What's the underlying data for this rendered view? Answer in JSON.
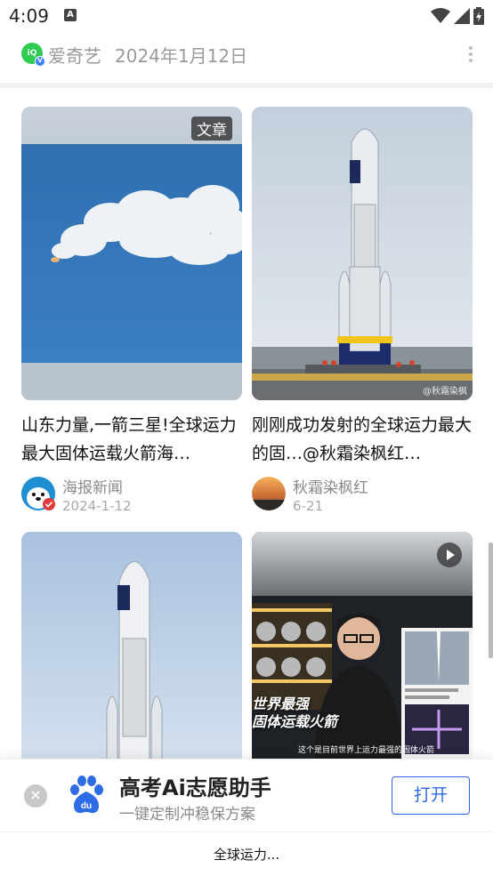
{
  "status_bar": {
    "time": "4:09"
  },
  "header": {
    "source": "爱奇艺",
    "date": "2024年1月12日"
  },
  "cards": [
    {
      "title": "山东力量,一箭三星!全球运力最大固体运载火箭海…",
      "author": "海报新闻",
      "date": "2024-1-12",
      "badge": "文章"
    },
    {
      "title": "刚刚成功发射的全球运力最大的固…@秋霜染枫红…",
      "author": "秋霜染枫红",
      "date": "6-21",
      "watermark": "@秋霜染枫"
    },
    {
      "title": "",
      "author": "",
      "date": ""
    },
    {
      "title": "",
      "author": "",
      "date": "",
      "overlay": [
        "世界最强",
        "固体运载火箭"
      ],
      "caption": "这个是目前世界上运力最强的固体火箭"
    }
  ],
  "banner": {
    "title": "高考Ai志愿助手",
    "subtitle": "一键定制冲稳保方案",
    "open_label": "打开"
  },
  "bottom": {
    "label": "全球运力..."
  },
  "colors": {
    "accent": "#2e6be6",
    "iqiyi_green": "#2fcb53"
  }
}
